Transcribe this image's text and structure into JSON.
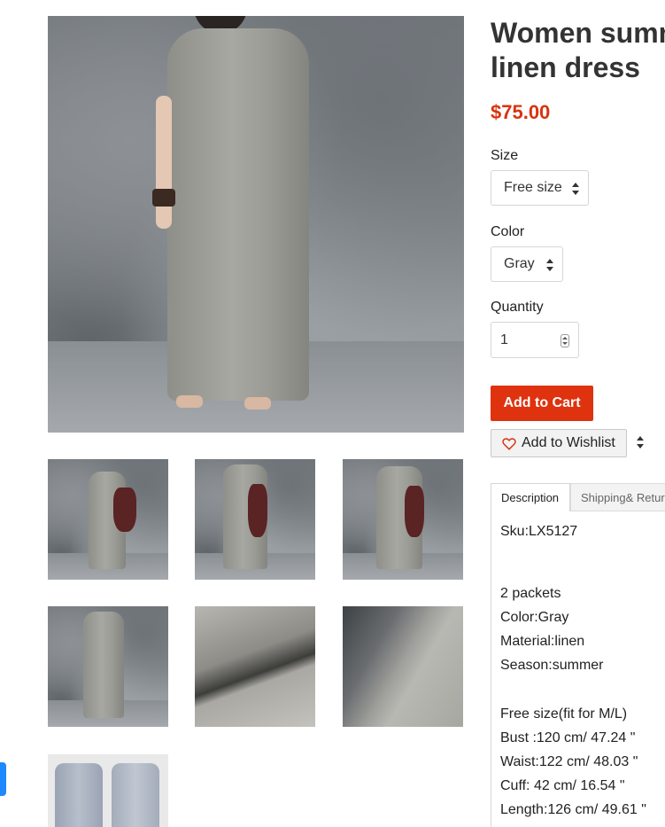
{
  "product": {
    "title_line1": "Women summ",
    "title_line2": "linen dress",
    "price": "$75.00"
  },
  "options": {
    "size_label": "Size",
    "size_value": "Free size",
    "color_label": "Color",
    "color_value": "Gray",
    "quantity_label": "Quantity",
    "quantity_value": "1"
  },
  "actions": {
    "add_to_cart": "Add to Cart",
    "add_to_wishlist": "Add to Wishlist"
  },
  "tabs": [
    {
      "label": "Description",
      "active": true
    },
    {
      "label": "Shipping& Retur",
      "active": false
    }
  ],
  "description_lines": [
    "Sku:LX5127",
    "2 packets",
    "Color:Gray",
    "Material:linen",
    "Season:summer",
    "Free size(fit for M/L)",
    "Bust :120 cm/ 47.24 \"",
    "Waist:122 cm/ 48.03 \"",
    "Cuff: 42 cm/ 16.54 \"",
    "Length:126 cm/ 49.61 \""
  ],
  "colors": {
    "price": "#d9330f",
    "cart_button": "#df320f",
    "edge_tab": "#1e88ff"
  },
  "icons": [
    "heart-icon",
    "select-arrows-icon",
    "spinner-icon"
  ]
}
